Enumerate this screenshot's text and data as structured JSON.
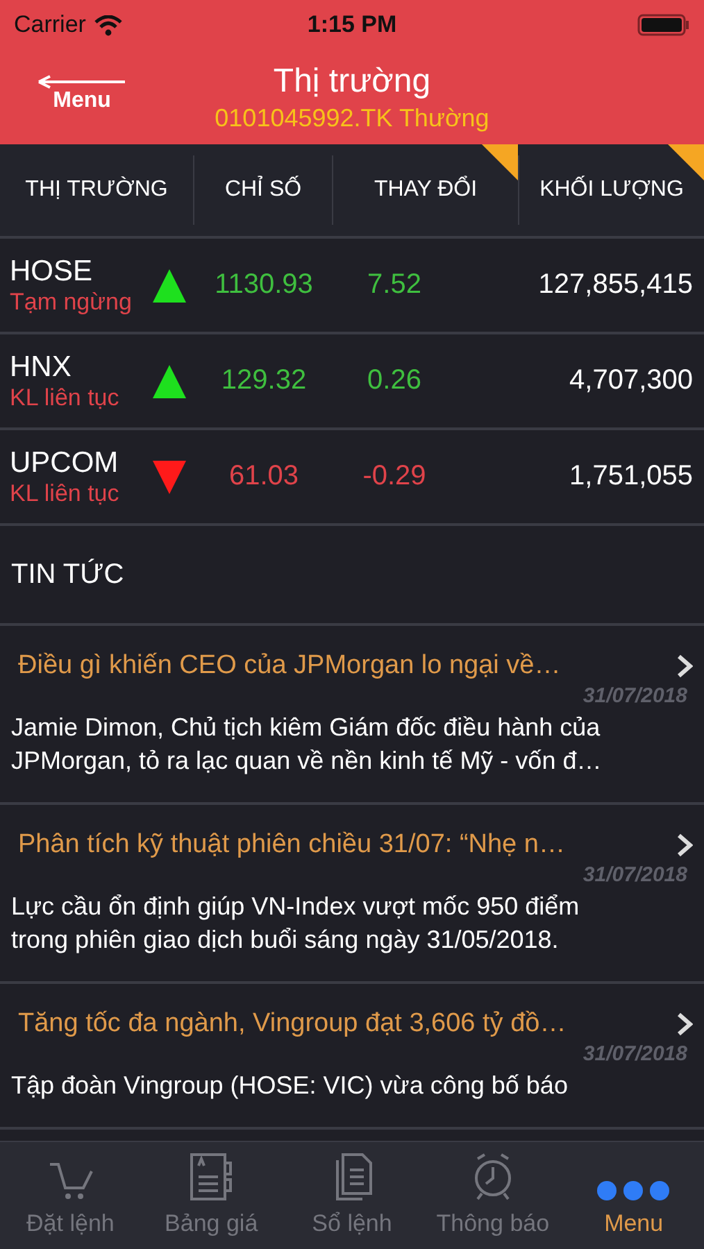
{
  "status_bar": {
    "carrier": "Carrier",
    "time": "1:15 PM"
  },
  "nav": {
    "back_label": "Menu",
    "title": "Thị trường",
    "subtitle": "0101045992.TK Thường"
  },
  "table": {
    "columns": [
      {
        "label": "THỊ TRƯỜNG",
        "sorted": false
      },
      {
        "label": "CHỈ SỐ",
        "sorted": false
      },
      {
        "label": "THAY ĐỔI",
        "sorted": true
      },
      {
        "label": "KHỐI LƯỢNG",
        "sorted": true
      }
    ],
    "rows": [
      {
        "market": "HOSE",
        "status": "Tạm ngừng",
        "kind": "up",
        "index": "1130.93",
        "change": "7.52",
        "volume": "127,855,415"
      },
      {
        "market": "HNX",
        "status": "KL liên tục",
        "kind": "up",
        "index": "129.32",
        "change": "0.26",
        "volume": "4,707,300"
      },
      {
        "market": "UPCOM",
        "status": "KL liên tục",
        "kind": "down",
        "index": "61.03",
        "change": "-0.29",
        "volume": "1,751,055"
      }
    ]
  },
  "news": {
    "heading": "TIN TỨC",
    "items": [
      {
        "title": "Điều gì khiến CEO của JPMorgan lo ngại về…",
        "date": "31/07/2018",
        "summary": "Jamie Dimon, Chủ tịch kiêm Giám đốc điều hành của JPMorgan, tỏ ra lạc quan về nền kinh tế Mỹ - vốn đ…"
      },
      {
        "title": "Phân tích kỹ thuật phiên chiều 31/07: “Nhẹ n…",
        "date": "31/07/2018",
        "summary": "Lực cầu ổn định giúp VN-Index vượt mốc 950 điểm trong phiên giao dịch buổi sáng ngày 31/05/2018."
      },
      {
        "title": "Tăng tốc đa ngành, Vingroup đạt 3,606 tỷ đồ…",
        "date": "31/07/2018",
        "summary": "Tập đoàn Vingroup (HOSE: VIC) vừa công bố báo"
      }
    ]
  },
  "tab_bar": [
    {
      "label": "Đặt lệnh",
      "selected": false
    },
    {
      "label": "Bảng giá",
      "selected": false
    },
    {
      "label": "Sổ lệnh",
      "selected": false
    },
    {
      "label": "Thông báo",
      "selected": false
    },
    {
      "label": "Menu",
      "selected": true
    }
  ]
}
